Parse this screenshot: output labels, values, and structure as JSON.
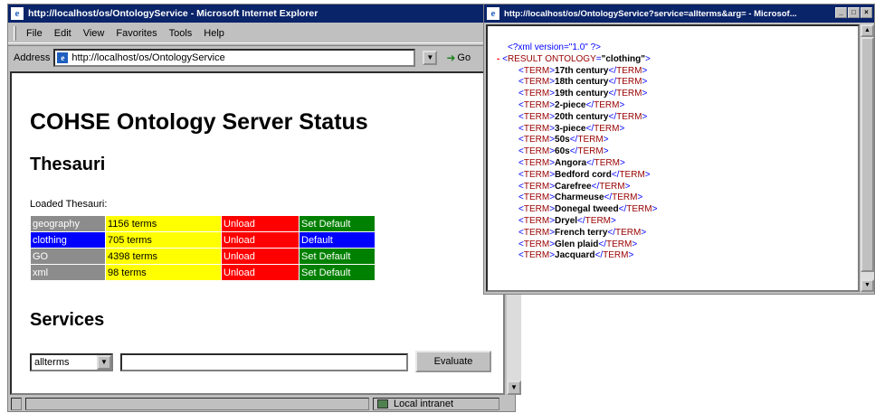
{
  "window1": {
    "title": "http://localhost/os/OntologyService - Microsoft Internet Explorer",
    "menu": [
      "File",
      "Edit",
      "View",
      "Favorites",
      "Tools",
      "Help"
    ],
    "address_label": "Address",
    "address_value": "http://localhost/os/OntologyService",
    "go_label": "Go",
    "status": {
      "zone": "Local intranet"
    }
  },
  "page": {
    "title": "COHSE Ontology Server Status",
    "thesauri_heading": "Thesauri",
    "loaded_label": "Loaded Thesauri:",
    "thesauri": [
      {
        "name": "geography",
        "terms": "1156 terms",
        "action": "Unload",
        "default": "Set Default",
        "name_color": "#8c8c8c",
        "default_color": "#008000"
      },
      {
        "name": "clothing",
        "terms": "705 terms",
        "action": "Unload",
        "default": "Default",
        "name_color": "#0000ff",
        "default_color": "#0000ff"
      },
      {
        "name": "GO",
        "terms": "4398 terms",
        "action": "Unload",
        "default": "Set Default",
        "name_color": "#8c8c8c",
        "default_color": "#008000"
      },
      {
        "name": "xml",
        "terms": "98 terms",
        "action": "Unload",
        "default": "Set Default",
        "name_color": "#8c8c8c",
        "default_color": "#008000"
      }
    ],
    "services_heading": "Services",
    "service_select": "allterms",
    "service_input": "",
    "evaluate_label": "Evaluate"
  },
  "window2": {
    "title": "http://localhost/os/OntologyService?service=allterms&arg= - Microsof...",
    "xml_decl": "<?xml version=\"1.0\" ?>",
    "root_tag": "RESULT",
    "root_attr_name": "ONTOLOGY",
    "root_attr_value": "\"clothing\"",
    "term_tag": "TERM",
    "terms": [
      "17th century",
      "18th century",
      "19th century",
      "2-piece",
      "20th century",
      "3-piece",
      "50s",
      "60s",
      "Angora",
      "Bedford cord",
      "Carefree",
      "Charmeuse",
      "Donegal tweed",
      "Dryel",
      "French terry",
      "Glen plaid",
      "Jacquard"
    ]
  },
  "colors": {
    "terms_bg": "#ffff00",
    "unload_bg": "#ff0000",
    "titlebar": "#0a246a"
  }
}
